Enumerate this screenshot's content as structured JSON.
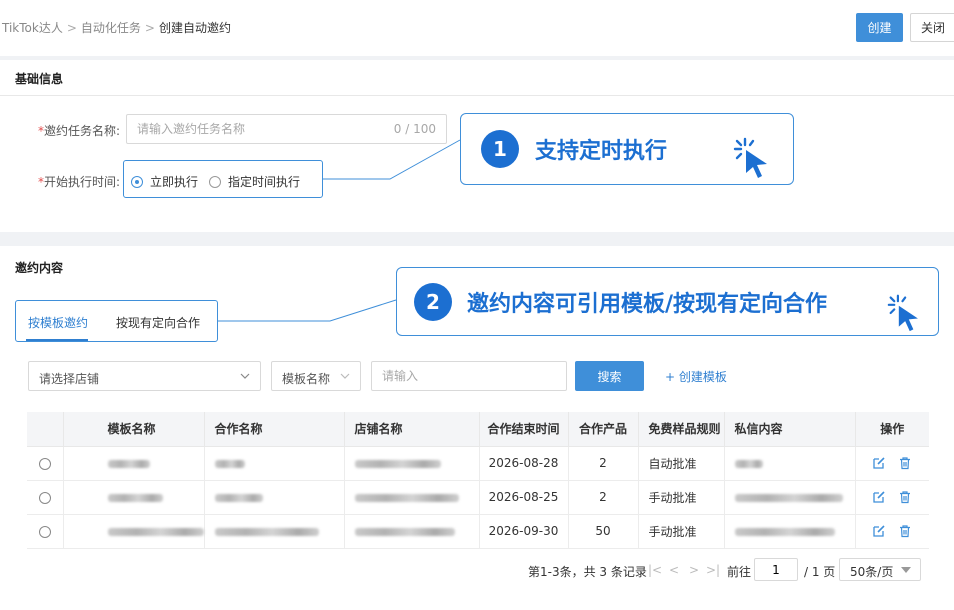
{
  "breadcrumb": [
    "TikTok达人",
    "自动化任务",
    "创建自动邀约"
  ],
  "header": {
    "create_label": "创建",
    "close_label": "关闭"
  },
  "basic_info": {
    "title": "基础信息",
    "name_label": "邀约任务名称:",
    "name_placeholder": "请输入邀约任务名称",
    "name_counter": "0 / 100",
    "start_label": "开始执行时间:",
    "start_options": [
      "立即执行",
      "指定时间执行"
    ],
    "start_selected": "立即执行"
  },
  "callouts": [
    {
      "number": "1",
      "text": "支持定时执行"
    },
    {
      "number": "2",
      "text": "邀约内容可引用模板/按现有定向合作"
    }
  ],
  "content": {
    "title": "邀约内容",
    "tabs": [
      "按模板邀约",
      "按现有定向合作"
    ],
    "active_tab": "按模板邀约",
    "store_placeholder": "请选择店铺",
    "template_select": "模板名称",
    "keyword_placeholder": "请输入",
    "search_label": "搜索",
    "create_template_label": "+ 创建模板"
  },
  "table": {
    "columns": [
      "",
      "模板名称",
      "合作名称",
      "店铺名称",
      "合作结束时间",
      "合作产品",
      "免费样品规则",
      "私信内容",
      "操作"
    ],
    "rows": [
      {
        "end_time": "2026-08-28",
        "products": "2",
        "sample_rule": "自动批准"
      },
      {
        "end_time": "2026-08-25",
        "products": "2",
        "sample_rule": "手动批准"
      },
      {
        "end_time": "2026-09-30",
        "products": "50",
        "sample_rule": "手动批准"
      }
    ],
    "actions": [
      "edit-icon",
      "delete-icon"
    ]
  },
  "pagination": {
    "summary": "第1-3条，共 3 条记录",
    "goto_label": "前往",
    "current_page": "1",
    "total_pages": "/ 1 页",
    "page_size": "50条/页"
  },
  "colors": {
    "accent": "#3f8fd9",
    "callout_text": "#1c6fd1",
    "required": "#e34d4d"
  }
}
